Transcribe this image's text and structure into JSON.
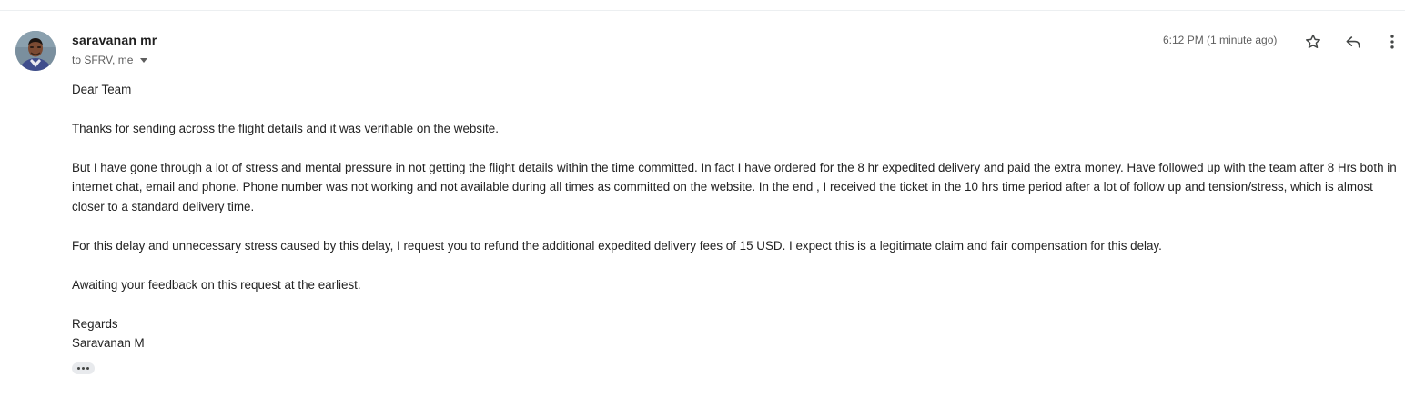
{
  "sender": {
    "name": "saravanan mr",
    "recipients": "to SFRV, me",
    "avatar_icon": "person-avatar"
  },
  "header": {
    "timestamp": "6:12 PM (1 minute ago)",
    "icons": {
      "star": "star-icon",
      "reply": "reply-icon",
      "more": "more-vert-icon"
    }
  },
  "body": {
    "greeting": "Dear Team",
    "paragraphs": [
      "Thanks for sending across the flight details and it was verifiable on the website.",
      "But I have gone through a lot of stress and mental pressure in not getting the flight details within the time committed. In fact I have ordered for the 8 hr expedited delivery and paid the extra money. Have followed up with the team after 8 Hrs both in internet chat, email and phone. Phone number was not working and not available during  all times as committed on the website. In the end , I received the ticket in the 10 hrs time period after a lot of follow up and tension/stress, which is almost closer to a standard delivery time.",
      "For this delay and unnecessary stress caused by this delay, I request you to refund the additional expedited delivery fees of 15 USD. I expect this is a legitimate claim and fair compensation for this delay.",
      "Awaiting your feedback on this request at the earliest."
    ],
    "closing": "Regards",
    "signature": "Saravanan M"
  },
  "trimmed_content_icon": "more-horiz-icon",
  "colors": {
    "text": "#222222",
    "secondary": "#5e5e5e",
    "icon": "#444746",
    "chip": "#e8eaed"
  }
}
